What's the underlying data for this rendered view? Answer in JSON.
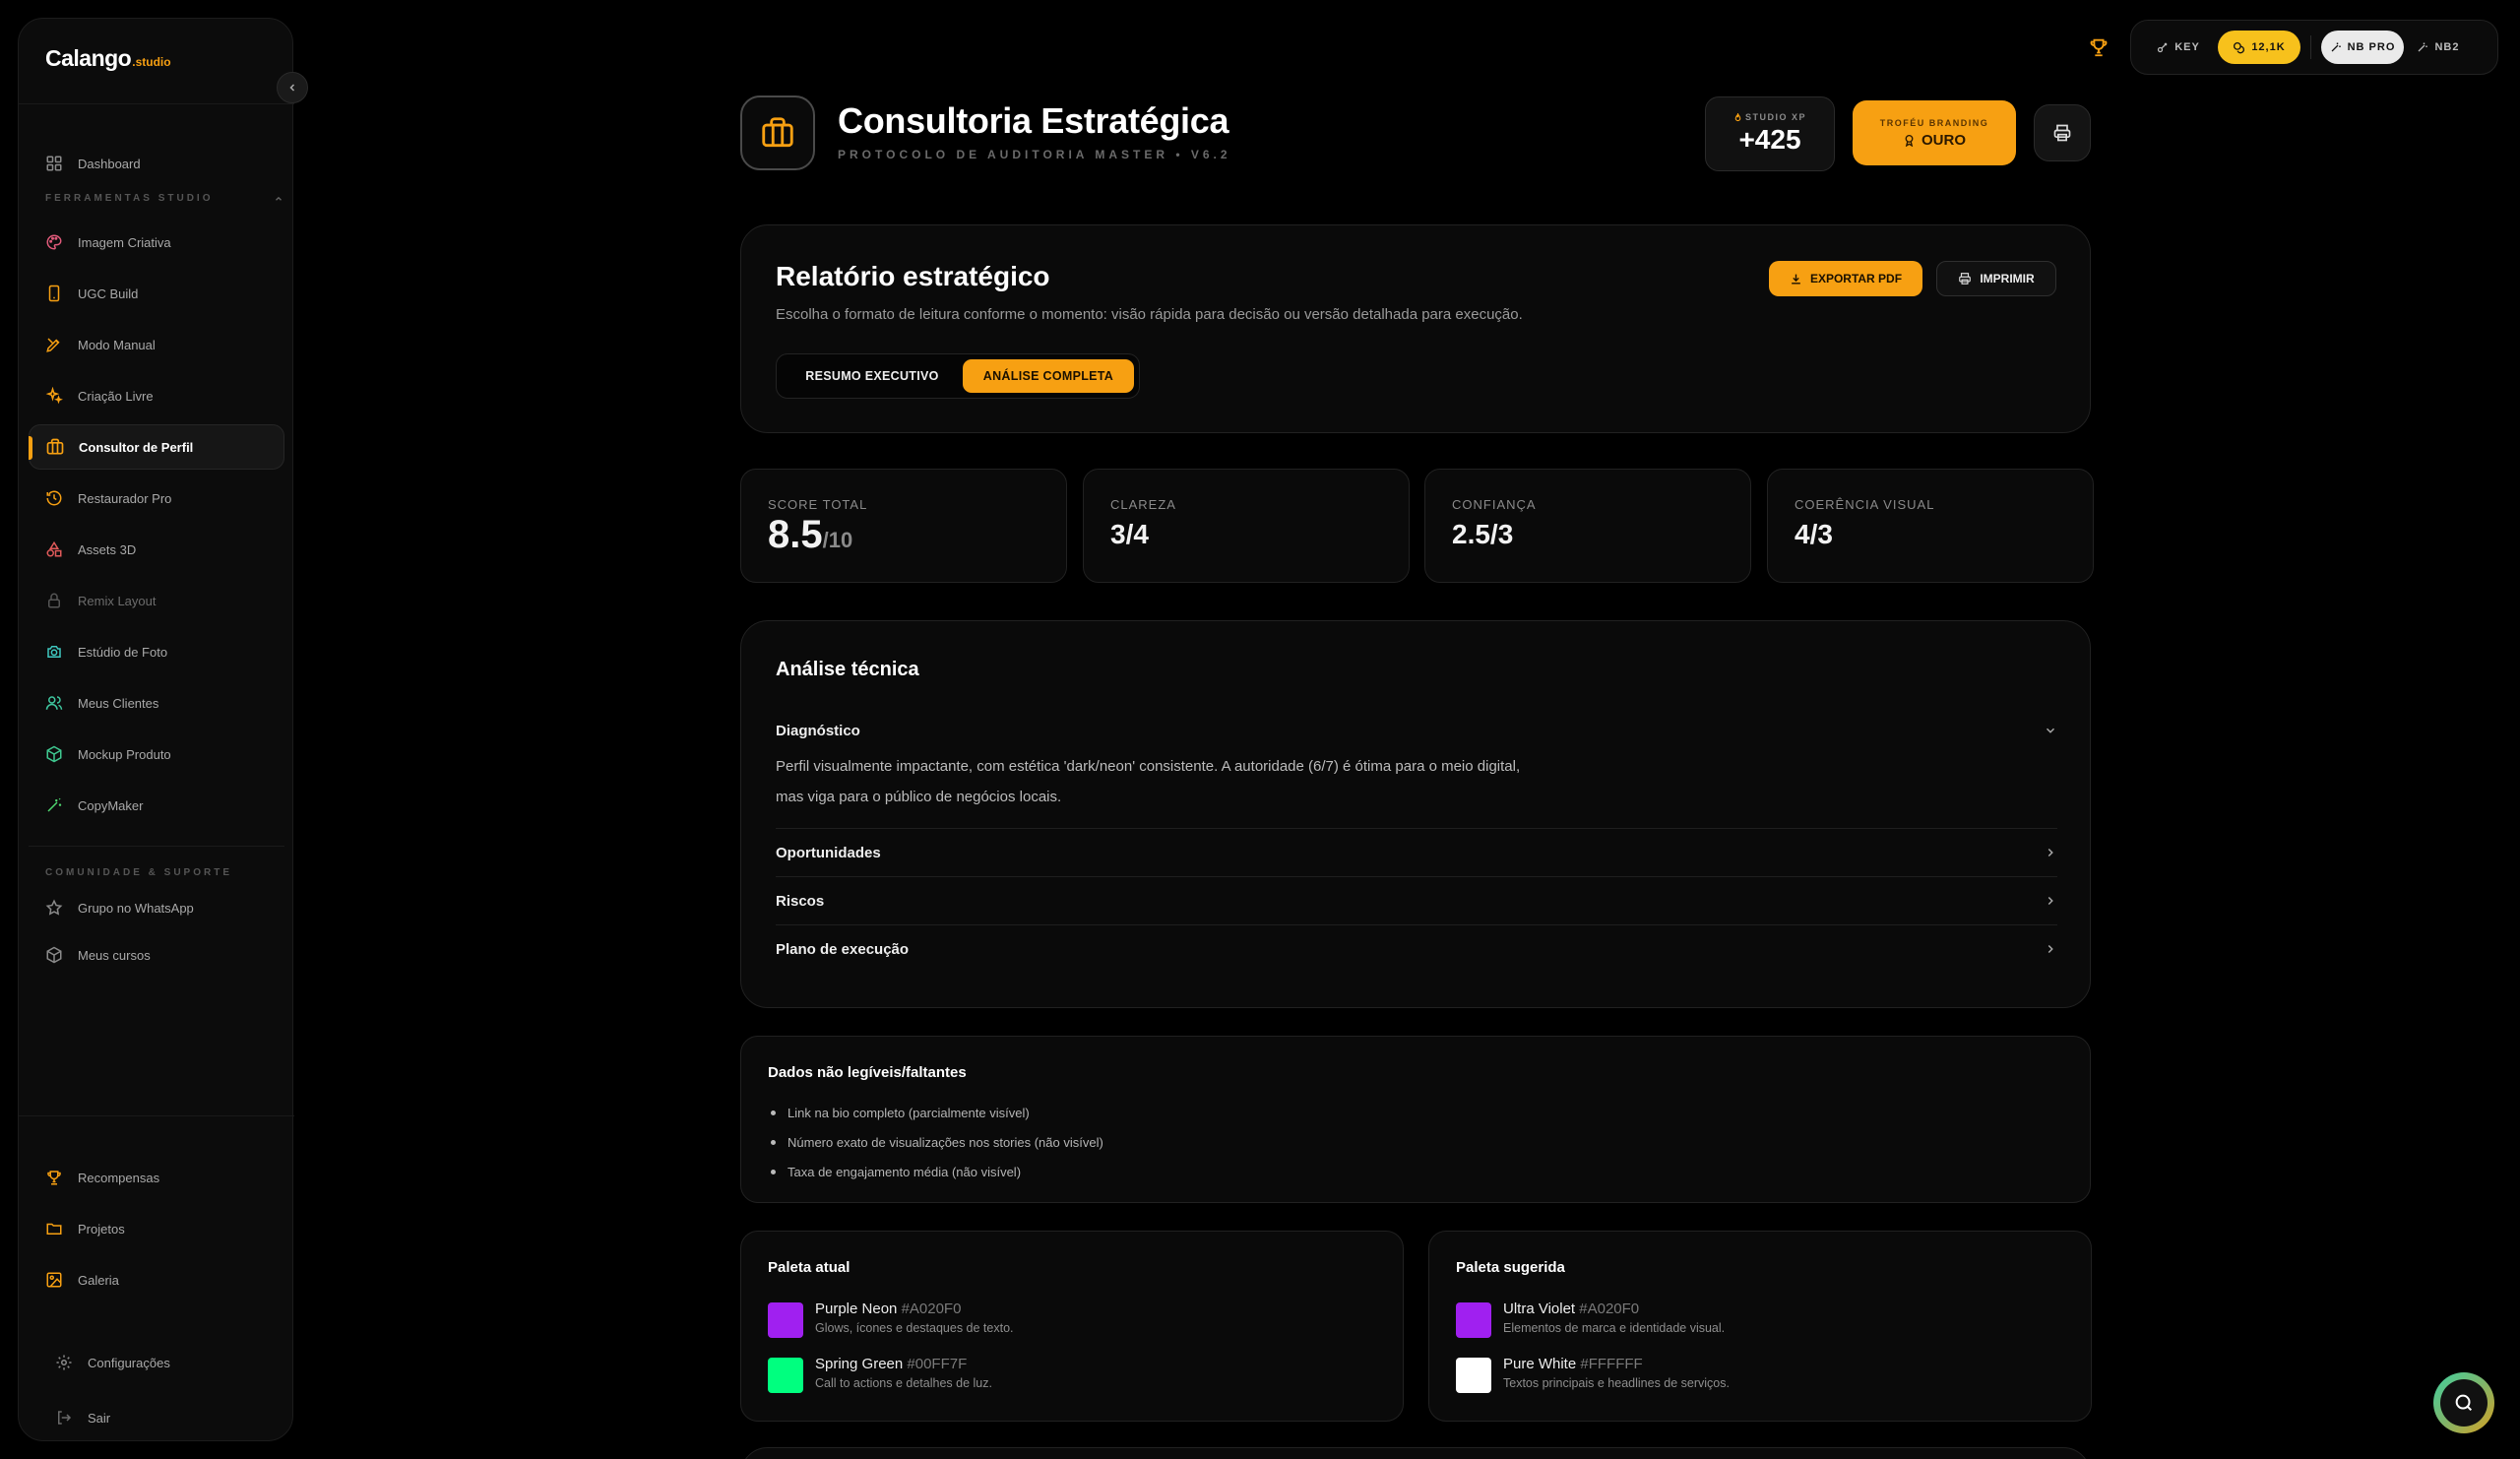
{
  "brand": {
    "name": "Calango",
    "suffix": ".studio"
  },
  "sidebar": {
    "items_top": [
      {
        "label": "Dashboard",
        "icon": "grid-icon"
      }
    ],
    "section1": "FERRAMENTAS STUDIO",
    "tools": [
      {
        "label": "Imagem Criativa",
        "icon": "palette-icon",
        "color": "#e05a7a"
      },
      {
        "label": "UGC Build",
        "icon": "phone-icon",
        "color": "#f7a012"
      },
      {
        "label": "Modo Manual",
        "icon": "pen-tool-icon",
        "color": "#f7a012"
      },
      {
        "label": "Criação Livre",
        "icon": "sparkles-icon",
        "color": "#f7a012"
      },
      {
        "label": "Consultor de Perfil",
        "icon": "briefcase-icon",
        "color": "#f7a012",
        "active": true
      },
      {
        "label": "Restaurador Pro",
        "icon": "history-icon",
        "color": "#f7a012"
      },
      {
        "label": "Assets 3D",
        "icon": "shapes-icon",
        "color": "#e05a5a"
      },
      {
        "label": "Remix Layout",
        "icon": "lock-icon",
        "color": "#555555",
        "locked": true
      },
      {
        "label": "Estúdio de Foto",
        "icon": "camera-icon",
        "color": "#3fc8c0"
      },
      {
        "label": "Meus Clientes",
        "icon": "users-icon",
        "color": "#3fc8a0"
      },
      {
        "label": "Mockup Produto",
        "icon": "package-icon",
        "color": "#3fc890"
      },
      {
        "label": "CopyMaker",
        "icon": "wand-icon",
        "color": "#4fd870"
      }
    ],
    "section2": "COMUNIDADE & SUPORTE",
    "community": [
      {
        "label": "Grupo no WhatsApp",
        "icon": "star-icon"
      },
      {
        "label": "Meus cursos",
        "icon": "cube-icon"
      }
    ],
    "bottom": [
      {
        "label": "Recompensas",
        "icon": "trophy-icon"
      },
      {
        "label": "Projetos",
        "icon": "folder-icon"
      },
      {
        "label": "Galeria",
        "icon": "image-icon"
      }
    ],
    "footer": [
      {
        "label": "Configurações",
        "icon": "gear-icon"
      },
      {
        "label": "Sair",
        "icon": "logout-icon"
      }
    ]
  },
  "topbar": {
    "key_label": "KEY",
    "coins": "12,1K",
    "model_active": "NB PRO",
    "model_other": "NB2"
  },
  "header": {
    "title": "Consultoria Estratégica",
    "subtitle": "PROTOCOLO DE AUDITORIA MASTER • V6.2",
    "xp_label": "STUDIO XP",
    "xp_value": "+425",
    "trophy_label": "TROFÉU BRANDING",
    "trophy_value": "OURO"
  },
  "report": {
    "title": "Relatório estratégico",
    "description": "Escolha o formato de leitura conforme o momento: visão rápida para decisão ou versão detalhada para execução.",
    "export_label": "EXPORTAR PDF",
    "print_label": "IMPRIMIR",
    "mode_summary": "RESUMO EXECUTIVO",
    "mode_full": "ANÁLISE COMPLETA"
  },
  "stats": [
    {
      "label": "SCORE TOTAL",
      "value": "8.5",
      "denominator": "/10"
    },
    {
      "label": "CLAREZA",
      "value": "3/4"
    },
    {
      "label": "CONFIANÇA",
      "value": "2.5/3"
    },
    {
      "label": "COERÊNCIA VISUAL",
      "value": "4/3"
    }
  ],
  "analysis": {
    "title": "Análise técnica",
    "diagnostic_label": "Diagnóstico",
    "diagnostic_line1": "Perfil visualmente impactante, com estética 'dark/neon' consistente. A autoridade (6/7) é ótima para o meio digital,",
    "diagnostic_line2": "mas viga para o público de negócios locais.",
    "opportunities_label": "Oportunidades",
    "risks_label": "Riscos",
    "plan_label": "Plano de execução"
  },
  "missing": {
    "title": "Dados não legíveis/faltantes",
    "items": [
      "Link na bio completo (parcialmente visível)",
      "Número exato de visualizações nos stories (não visível)",
      "Taxa de engajamento média (não visível)"
    ]
  },
  "palette_current": {
    "title": "Paleta atual",
    "colors": [
      {
        "name": "Purple Neon",
        "hex": "#A020F0",
        "desc": "Glows, ícones e destaques de texto."
      },
      {
        "name": "Spring Green",
        "hex": "#00FF7F",
        "desc": "Call to actions e detalhes de luz."
      }
    ]
  },
  "palette_suggested": {
    "title": "Paleta sugerida",
    "colors": [
      {
        "name": "Ultra Violet",
        "hex": "#A020F0",
        "desc": "Elementos de marca e identidade visual."
      },
      {
        "name": "Pure White",
        "hex": "#FFFFFF",
        "desc": "Textos principais e headlines de serviços."
      }
    ]
  },
  "colors": {
    "accent": "#F7A012",
    "coin": "#F7C11C",
    "background": "#000000",
    "card": "#0A0A0A"
  }
}
